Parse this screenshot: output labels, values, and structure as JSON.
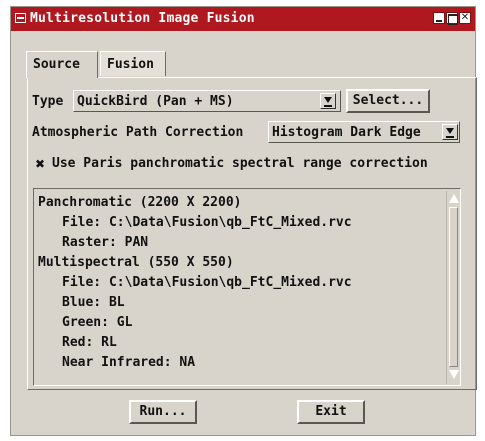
{
  "window": {
    "title": "Multiresolution Image Fusion",
    "titlebar_color": "#b01820",
    "close_glyph": "✕"
  },
  "tabs": [
    {
      "label": "Source",
      "active": true
    },
    {
      "label": "Fusion",
      "active": false
    }
  ],
  "source": {
    "type_label": "Type",
    "type_value": "QuickBird (Pan + MS)",
    "select_button": "Select...",
    "atmos_label": "Atmospheric Path Correction",
    "atmos_value": "Histogram Dark Edge",
    "checkbox_label": "Use Paris panchromatic spectral range correction",
    "checkbox_checked": true,
    "checkbox_glyph": "✖",
    "info_lines": [
      "Panchromatic (2200 X 2200)",
      "File: C:\\Data\\Fusion\\qb_FtC_Mixed.rvc",
      "Raster: PAN",
      "Multispectral (550 X 550)",
      "File: C:\\Data\\Fusion\\qb_FtC_Mixed.rvc",
      "Blue: BL",
      "Green: GL",
      "Red: RL",
      "Near Infrared: NA"
    ]
  },
  "footer": {
    "run_button": "Run...",
    "exit_button": "Exit"
  }
}
